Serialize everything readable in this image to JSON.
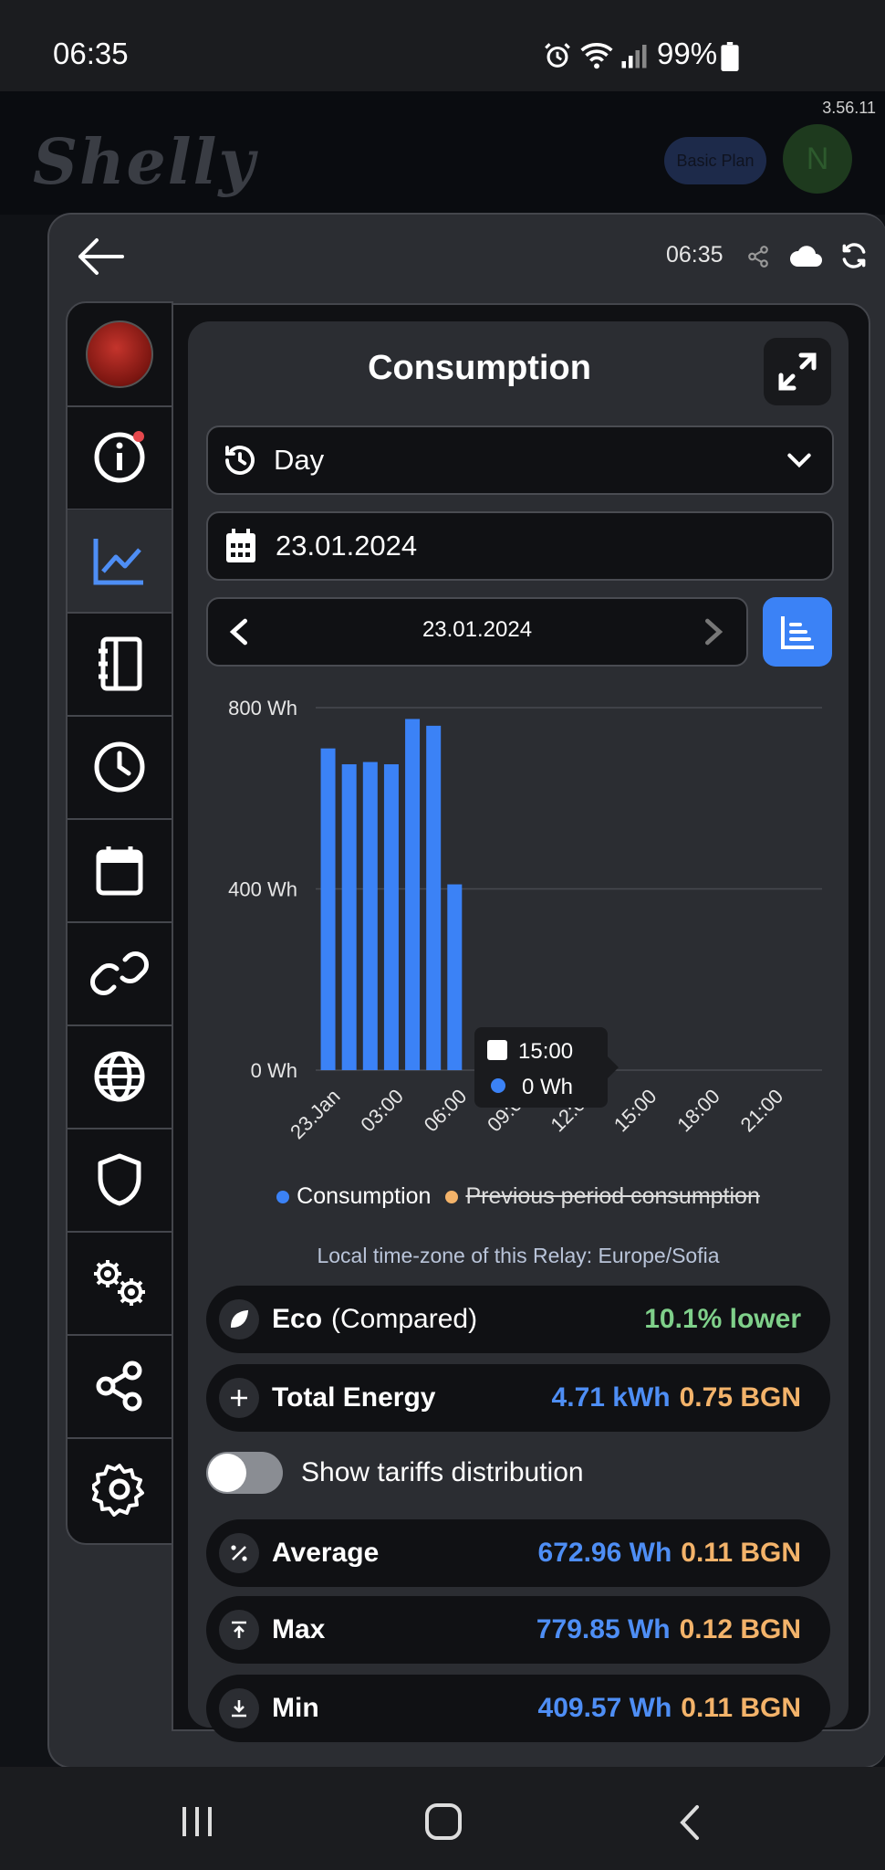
{
  "status_bar": {
    "time": "06:35",
    "battery": "99%"
  },
  "app": {
    "version": "3.56.11",
    "logo": "Shelly",
    "plan_badge": "Basic Plan",
    "avatar_initial": "N"
  },
  "dialog": {
    "time": "06:35"
  },
  "sidebar": {
    "items": [
      {
        "name": "device-thumbnail"
      },
      {
        "name": "info",
        "notification": true
      },
      {
        "name": "statistics",
        "active": true
      },
      {
        "name": "schedule-table"
      },
      {
        "name": "timer"
      },
      {
        "name": "calendar"
      },
      {
        "name": "link"
      },
      {
        "name": "internet"
      },
      {
        "name": "security"
      },
      {
        "name": "advanced-settings"
      },
      {
        "name": "share"
      },
      {
        "name": "settings"
      }
    ]
  },
  "consumption": {
    "title": "Consumption",
    "period": "Day",
    "date_input": "23.01.2024",
    "nav_date": "23.01.2024",
    "tz_note": "Local time-zone of this Relay: Europe/Sofia",
    "tooltip": {
      "time": "15:00",
      "value": "0 Wh"
    }
  },
  "chart_data": {
    "type": "bar",
    "ylim": [
      0,
      800
    ],
    "yticks": [
      "0 Wh",
      "400 Wh",
      "800 Wh"
    ],
    "xticks": [
      "23.Jan",
      "03:00",
      "06:00",
      "09:00",
      "12:00",
      "15:00",
      "18:00",
      "21:00"
    ],
    "hours": [
      0,
      1,
      2,
      3,
      4,
      5,
      6
    ],
    "series": [
      {
        "name": "Consumption",
        "color": "#3b82f6",
        "values": [
          710,
          675,
          680,
          675,
          775,
          760,
          410
        ]
      },
      {
        "name": "Previous period consumption",
        "color": "#f3b36a",
        "hidden": true,
        "values": []
      }
    ]
  },
  "legend": {
    "series1": "Consumption",
    "series2": "Previous period consumption"
  },
  "stats": {
    "eco": {
      "label": "Eco",
      "suffix": "(Compared)",
      "value": "10.1% lower"
    },
    "total": {
      "label": "Total Energy",
      "energy": "4.71 kWh",
      "cost": "0.75 BGN"
    },
    "tariffs_toggle": "Show tariffs distribution",
    "average": {
      "label": "Average",
      "energy": "672.96 Wh",
      "cost": "0.11 BGN"
    },
    "max": {
      "label": "Max",
      "energy": "779.85 Wh",
      "cost": "0.12 BGN"
    },
    "min": {
      "label": "Min",
      "energy": "409.57 Wh",
      "cost": "0.11 BGN"
    }
  }
}
